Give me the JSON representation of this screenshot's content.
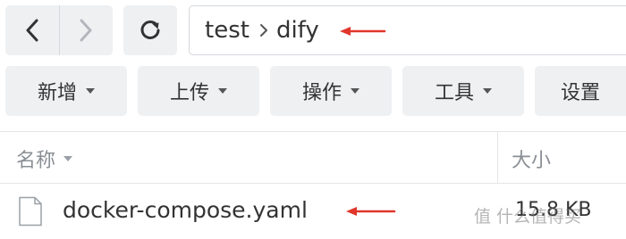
{
  "nav": {
    "back_icon": "chevron-left-icon",
    "forward_icon": "chevron-right-icon",
    "refresh_icon": "refresh-icon"
  },
  "path": {
    "segments": [
      "test",
      "dify"
    ],
    "separator_icon": "chevron-right-icon"
  },
  "toolbar": {
    "buttons": [
      {
        "label": "新增",
        "has_dropdown": true
      },
      {
        "label": "上传",
        "has_dropdown": true
      },
      {
        "label": "操作",
        "has_dropdown": true
      },
      {
        "label": "工具",
        "has_dropdown": true
      },
      {
        "label": "设置",
        "has_dropdown": false
      }
    ]
  },
  "table": {
    "columns": [
      "名称",
      "大小"
    ],
    "rows": [
      {
        "name": "docker-compose.yaml",
        "size": "15.8 KB",
        "icon": "file-icon"
      }
    ]
  },
  "annotations": {
    "arrow_color": "#e0362b"
  },
  "watermark": "值 什么值得买",
  "colors": {
    "button_bg": "#eef0f2",
    "border": "#d5d8dc",
    "header_text": "#8a8f95"
  }
}
